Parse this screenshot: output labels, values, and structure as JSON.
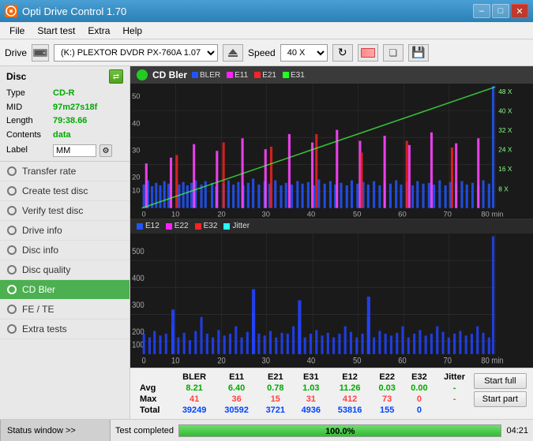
{
  "titlebar": {
    "title": "Opti Drive Control 1.70",
    "icon_label": "O"
  },
  "menu": {
    "items": [
      "File",
      "Start test",
      "Extra",
      "Help"
    ]
  },
  "toolbar": {
    "drive_label": "Drive",
    "drive_value": "(K:)  PLEXTOR DVDR  PX-760A 1.07",
    "speed_label": "Speed",
    "speed_value": "40 X"
  },
  "sidebar": {
    "disc_title": "Disc",
    "disc_type_label": "Type",
    "disc_type_value": "CD-R",
    "disc_mid_label": "MID",
    "disc_mid_value": "97m27s18f",
    "disc_length_label": "Length",
    "disc_length_value": "79:38.66",
    "disc_contents_label": "Contents",
    "disc_contents_value": "data",
    "disc_label_label": "Label",
    "disc_label_value": "MM",
    "nav_items": [
      {
        "id": "transfer-rate",
        "label": "Transfer rate",
        "active": false
      },
      {
        "id": "create-test-disc",
        "label": "Create test disc",
        "active": false
      },
      {
        "id": "verify-test-disc",
        "label": "Verify test disc",
        "active": false
      },
      {
        "id": "drive-info",
        "label": "Drive info",
        "active": false
      },
      {
        "id": "disc-info",
        "label": "Disc info",
        "active": false
      },
      {
        "id": "disc-quality",
        "label": "Disc quality",
        "active": false
      },
      {
        "id": "cd-bler",
        "label": "CD Bler",
        "active": true
      },
      {
        "id": "fe-te",
        "label": "FE / TE",
        "active": false
      },
      {
        "id": "extra-tests",
        "label": "Extra tests",
        "active": false
      }
    ]
  },
  "chart": {
    "title": "CD Bler",
    "top_legend": [
      "BLER",
      "E11",
      "E21",
      "E31"
    ],
    "top_legend_colors": [
      "#2255ff",
      "#ff22ff",
      "#ff2222",
      "#22ff22"
    ],
    "bottom_legend": [
      "E12",
      "E22",
      "E32",
      "Jitter"
    ],
    "bottom_legend_colors": [
      "#2255ff",
      "#ff22ff",
      "#ff2222",
      "#22ffff"
    ],
    "x_max": 80,
    "top_y_max": 50,
    "bottom_y_max": 500,
    "right_y_labels_top": [
      "48 X",
      "40 X",
      "32 X",
      "24 X",
      "16 X",
      "8 X"
    ],
    "x_axis_labels": [
      "0",
      "10",
      "20",
      "30",
      "40",
      "50",
      "60",
      "70",
      "80 min"
    ]
  },
  "table": {
    "columns": [
      "BLER",
      "E11",
      "E21",
      "E31",
      "E12",
      "E22",
      "E32",
      "Jitter"
    ],
    "rows": [
      {
        "label": "Avg",
        "values": [
          "8.21",
          "6.40",
          "0.78",
          "1.03",
          "11.26",
          "0.03",
          "0.00",
          "-"
        ],
        "class": "avg"
      },
      {
        "label": "Max",
        "values": [
          "41",
          "36",
          "15",
          "31",
          "412",
          "73",
          "0",
          "-"
        ],
        "class": "max"
      },
      {
        "label": "Total",
        "values": [
          "39249",
          "30592",
          "3721",
          "4936",
          "53816",
          "155",
          "0",
          ""
        ],
        "class": "total"
      }
    ],
    "buttons": [
      "Start full",
      "Start part"
    ]
  },
  "statusbar": {
    "window_label": "Status window >>",
    "progress_pct": 100,
    "progress_text": "100.0%",
    "time": "04:21",
    "message": "Test completed"
  }
}
